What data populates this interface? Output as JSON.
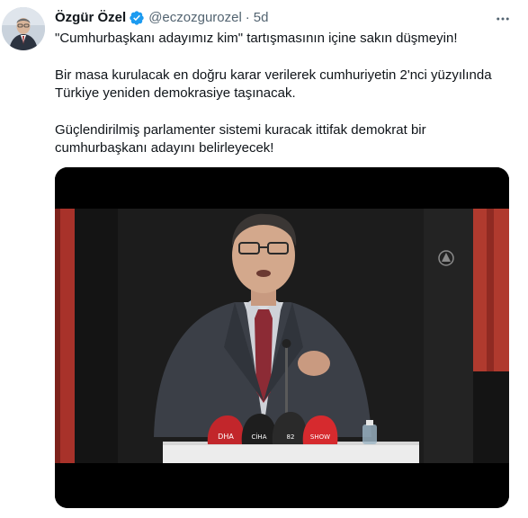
{
  "tweet": {
    "author": {
      "name": "Özgür Özel",
      "handle": "@eczozgurozel",
      "verified": true
    },
    "separator": "·",
    "timestamp": "5d",
    "text": {
      "p1": "\"Cumhurbaşkanı adayımız kim\" tartışmasının içine sakın düşmeyin!",
      "p2": "Bir masa kurulacak en doğru karar verilerek cumhuriyetin 2'nci yüzyılında Türkiye yeniden demokrasiye taşınacak.",
      "p3": "Güçlendirilmiş parlamenter sistemi kuracak ittifak demokrat bir cumhurbaşkanı adayını belirleyecek!"
    },
    "media": {
      "type": "video",
      "microphone_labels": {
        "dha": "DHA",
        "cihan": "CİHA",
        "ntv": "82",
        "show": "SHOW"
      }
    }
  },
  "colors": {
    "text_primary": "#0f1419",
    "text_secondary": "#536471",
    "verified_blue": "#1d9bf0",
    "curtain_red": "#a8322a"
  },
  "icons": {
    "verified": "verified-badge-icon",
    "more": "more-horizontal-icon",
    "watermark": "news-agency-logo-icon"
  }
}
